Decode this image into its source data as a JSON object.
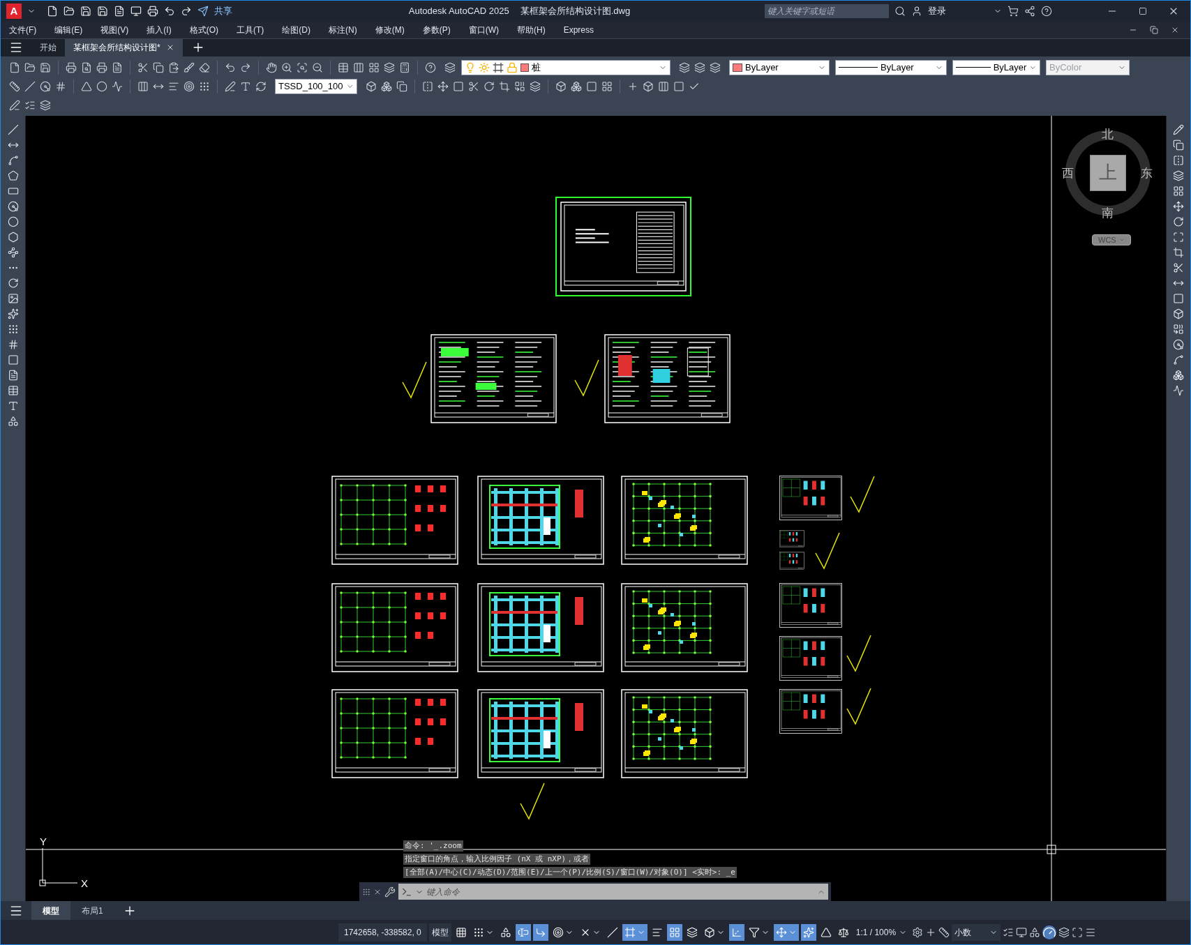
{
  "title_bar": {
    "logo": "A",
    "share": "共享",
    "app_name": "Autodesk AutoCAD 2025",
    "file_name": "某框架会所结构设计图.dwg",
    "search": {
      "placeholder": "键入关键字或短语"
    },
    "user": "登录"
  },
  "menu": [
    "文件(F)",
    "编辑(E)",
    "视图(V)",
    "插入(I)",
    "格式(O)",
    "工具(T)",
    "绘图(D)",
    "标注(N)",
    "修改(M)",
    "参数(P)",
    "窗口(W)",
    "帮助(H)",
    "Express"
  ],
  "doc_tabs": [
    {
      "label": "开始",
      "selected": false
    },
    {
      "label": "某框架会所结构设计图*",
      "selected": true
    }
  ],
  "properties": {
    "layer": "桩",
    "text_style": "TSSD_100_100",
    "color_control": "ByLayer",
    "linetype": "ByLayer",
    "lineweight": "ByLayer",
    "plot_style": {
      "value": "ByColor",
      "disabled": true
    }
  },
  "sheets": [
    {
      "kind": "cover",
      "selected": true
    },
    {
      "kind": "notes",
      "selected": false
    },
    {
      "kind": "details",
      "selected": false
    },
    {
      "kind": "columns",
      "selected": false
    },
    {
      "kind": "beams",
      "selected": false
    },
    {
      "kind": "slab",
      "selected": false
    },
    {
      "kind": "columns",
      "selected": false
    },
    {
      "kind": "beams",
      "selected": false
    },
    {
      "kind": "slab",
      "selected": false
    },
    {
      "kind": "columns",
      "selected": false
    },
    {
      "kind": "beams",
      "selected": false
    },
    {
      "kind": "slab",
      "selected": false
    },
    {
      "kind": "small",
      "selected": false
    },
    {
      "kind": "small",
      "selected": false
    },
    {
      "kind": "small",
      "selected": false
    },
    {
      "kind": "small",
      "selected": false
    },
    {
      "kind": "small",
      "selected": false
    },
    {
      "kind": "small",
      "selected": false
    }
  ],
  "viewcube": {
    "north": "北",
    "west": "西",
    "east": "东",
    "south": "南",
    "top": "上",
    "ucs": "WCS"
  },
  "ucs_icon": {
    "y": "Y",
    "x": "X"
  },
  "command_history": [
    "命令: '_.zoom",
    "指定窗口的角点，输入比例因子 (nX 或 nXP)，或者",
    "[全部(A)/中心(C)/动态(D)/范围(E)/上一个(P)/比例(S)/窗口(W)/对象(O)] <实时>: _e"
  ],
  "command_line": {
    "placeholder": "键入命令"
  },
  "layout_tabs": [
    {
      "label": "模型",
      "selected": true
    },
    {
      "label": "布局1",
      "selected": false
    }
  ],
  "status_bar": {
    "coordinates": "1742658, -338582, 0",
    "space": "模型",
    "scale": "1:1 / 100%",
    "units": "小数",
    "toggles": [
      {
        "kind": "grid",
        "on": false,
        "dropdown": false
      },
      {
        "kind": "snap",
        "on": false,
        "dropdown": true
      },
      {
        "kind": "infer",
        "on": false,
        "dropdown": false
      },
      {
        "kind": "dynamic_input",
        "on": true,
        "dropdown": false
      },
      {
        "kind": "ortho",
        "on": true,
        "dropdown": false
      },
      {
        "kind": "polar",
        "on": false,
        "dropdown": true
      },
      {
        "kind": "isodraft",
        "on": false,
        "dropdown": true
      },
      {
        "kind": "angle",
        "on": false,
        "dropdown": false
      },
      {
        "kind": "osnap",
        "on": true,
        "dropdown": true
      },
      {
        "kind": "lineweight",
        "on": false,
        "dropdown": false
      },
      {
        "kind": "transparency",
        "on": true,
        "dropdown": false
      },
      {
        "kind": "selection_cycling",
        "on": false,
        "dropdown": false
      },
      {
        "kind": "osnap_3d",
        "on": false,
        "dropdown": true
      },
      {
        "kind": "dynamic_ucs",
        "on": true,
        "dropdown": false
      },
      {
        "kind": "selection_filter",
        "on": false,
        "dropdown": true
      },
      {
        "kind": "gizmo",
        "on": true,
        "dropdown": true
      },
      {
        "kind": "annotation_visibility",
        "on": true,
        "dropdown": false
      },
      {
        "kind": "autoscale",
        "on": false,
        "dropdown": false
      },
      {
        "kind": "annotation_scale",
        "on": false,
        "dropdown": false
      }
    ]
  }
}
